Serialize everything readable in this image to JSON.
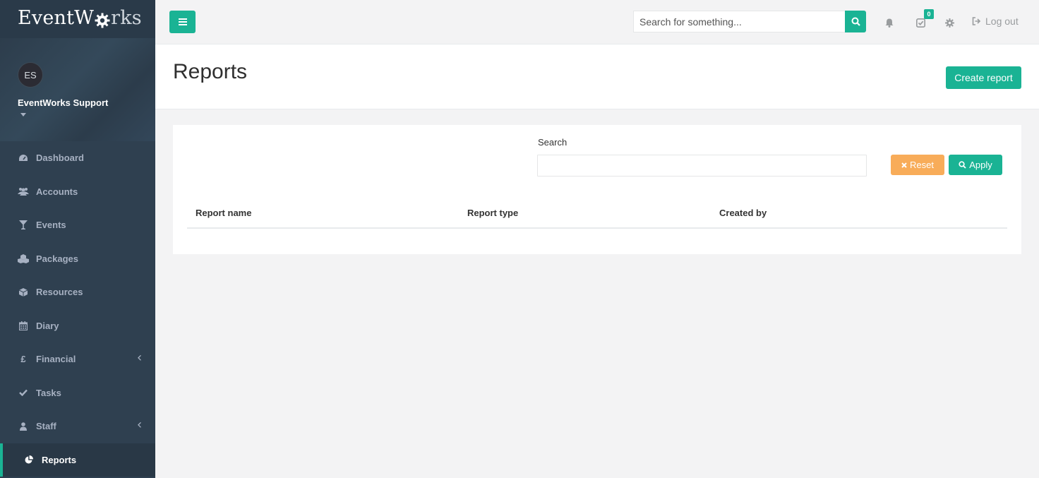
{
  "brand": {
    "logo_prefix": "EventW",
    "logo_suffix": "rks",
    "accent": "#1ab394",
    "sidebar_bg": "#2f4050",
    "warning": "#f8ac59"
  },
  "profile": {
    "initials": "ES",
    "name": "EventWorks Support",
    "caret_icon": "caret-down-icon"
  },
  "sidebar": {
    "items": [
      {
        "label": "Dashboard",
        "icon": "dashboard-icon"
      },
      {
        "label": "Accounts",
        "icon": "users-icon"
      },
      {
        "label": "Events",
        "icon": "cocktail-glass-icon"
      },
      {
        "label": "Packages",
        "icon": "cubes-icon"
      },
      {
        "label": "Resources",
        "icon": "cube-icon"
      },
      {
        "label": "Diary",
        "icon": "calendar-icon"
      },
      {
        "label": "Financial",
        "icon": "pound-icon",
        "has_submenu": true
      },
      {
        "label": "Tasks",
        "icon": "check-icon"
      },
      {
        "label": "Staff",
        "icon": "user-icon",
        "has_submenu": true
      },
      {
        "label": "Reports",
        "icon": "pie-chart-icon",
        "active": true
      }
    ]
  },
  "topbar": {
    "search_placeholder": "Search for something...",
    "tasks_count": "0",
    "logout_label": "Log out"
  },
  "page": {
    "title": "Reports",
    "create_label": "Create report"
  },
  "filters": {
    "search_label": "Search",
    "search_value": "",
    "reset_label": "Reset",
    "apply_label": "Apply"
  },
  "table": {
    "columns": [
      "Report name",
      "Report type",
      "Created by"
    ],
    "rows": []
  }
}
